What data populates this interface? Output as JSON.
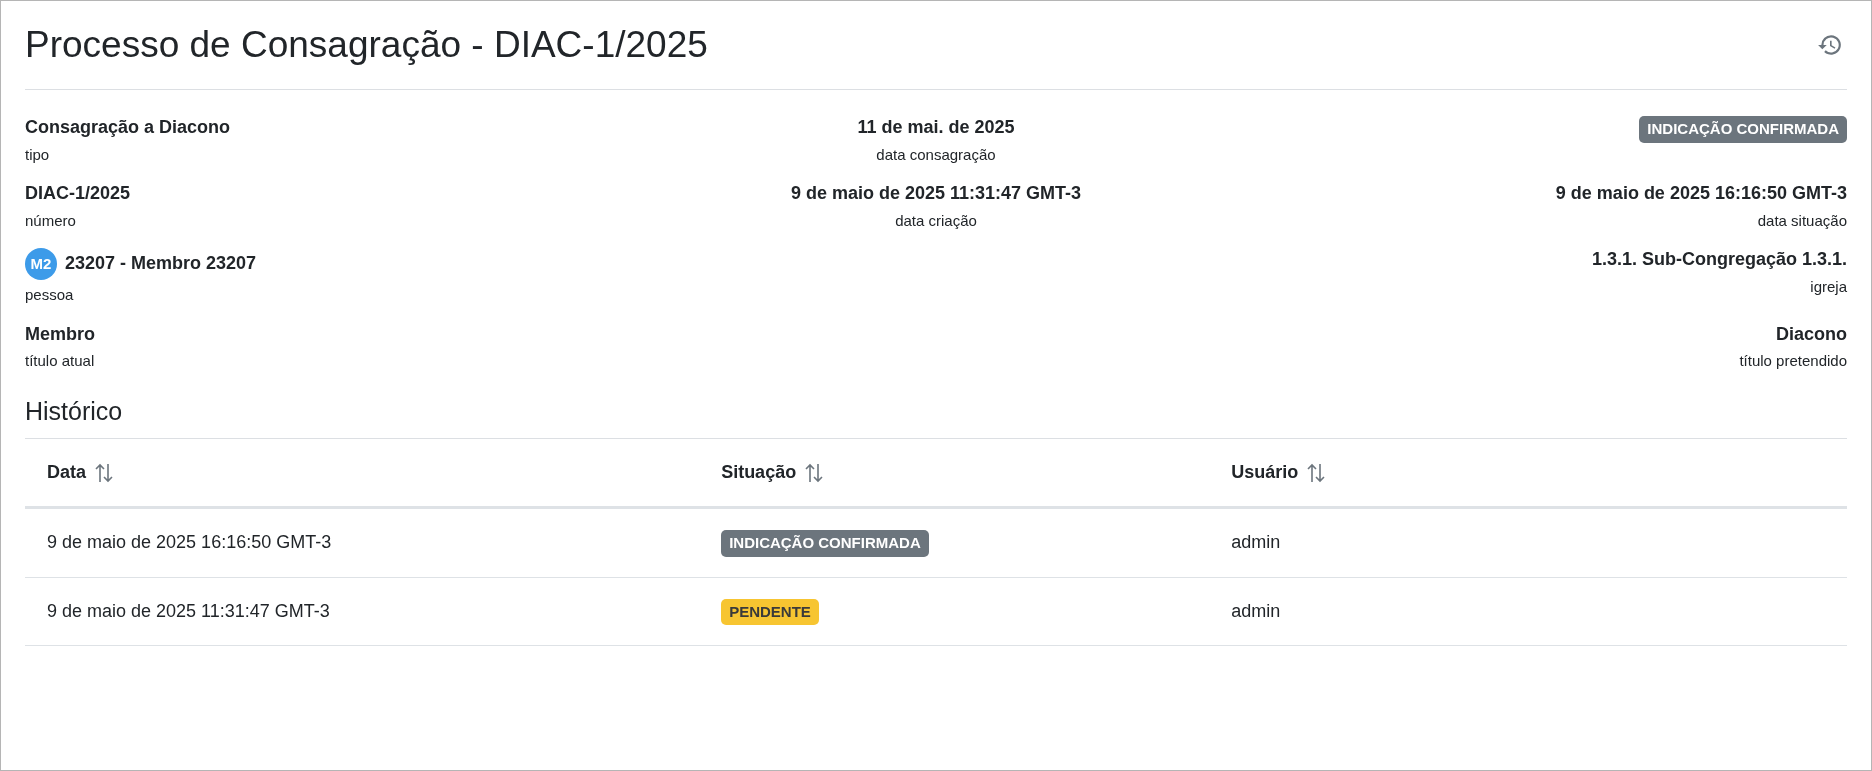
{
  "title": "Processo de Consagração - DIAC-1/2025",
  "details": [
    {
      "left": {
        "kind": "text",
        "value": "Consagração a Diacono",
        "label": "tipo"
      },
      "center": {
        "kind": "text",
        "value": "11 de mai. de 2025",
        "label": "data consagração"
      },
      "right": {
        "kind": "badge",
        "value": "INDICAÇÃO CONFIRMADA",
        "color": "#6c757d"
      }
    },
    {
      "left": {
        "kind": "text",
        "value": "DIAC-1/2025",
        "label": "número"
      },
      "center": {
        "kind": "text",
        "value": "9 de maio de 2025 11:31:47 GMT-3",
        "label": "data criação"
      },
      "right": {
        "kind": "text",
        "value": "9 de maio de 2025 16:16:50 GMT-3",
        "label": "data situação"
      }
    },
    {
      "left": {
        "kind": "person",
        "avatar": "M2",
        "value": "23207 - Membro 23207",
        "label": "pessoa"
      },
      "right": {
        "kind": "text",
        "value": "1.3.1. Sub-Congregação 1.3.1.",
        "label": "igreja"
      }
    },
    {
      "left": {
        "kind": "text",
        "value": "Membro",
        "label": "título atual"
      },
      "right": {
        "kind": "text",
        "value": "Diacono",
        "label": "título pretendido"
      }
    }
  ],
  "history": {
    "title": "Histórico",
    "columns": [
      "Data",
      "Situação",
      "Usuário"
    ],
    "rows": [
      {
        "date": "9 de maio de 2025 16:16:50 GMT-3",
        "status": "INDICAÇÃO CONFIRMADA",
        "color": "#6c757d",
        "user": "admin"
      },
      {
        "date": "9 de maio de 2025 11:31:47 GMT-3",
        "status": "PENDENTE",
        "color": "#f7c531",
        "user": "admin"
      }
    ]
  }
}
